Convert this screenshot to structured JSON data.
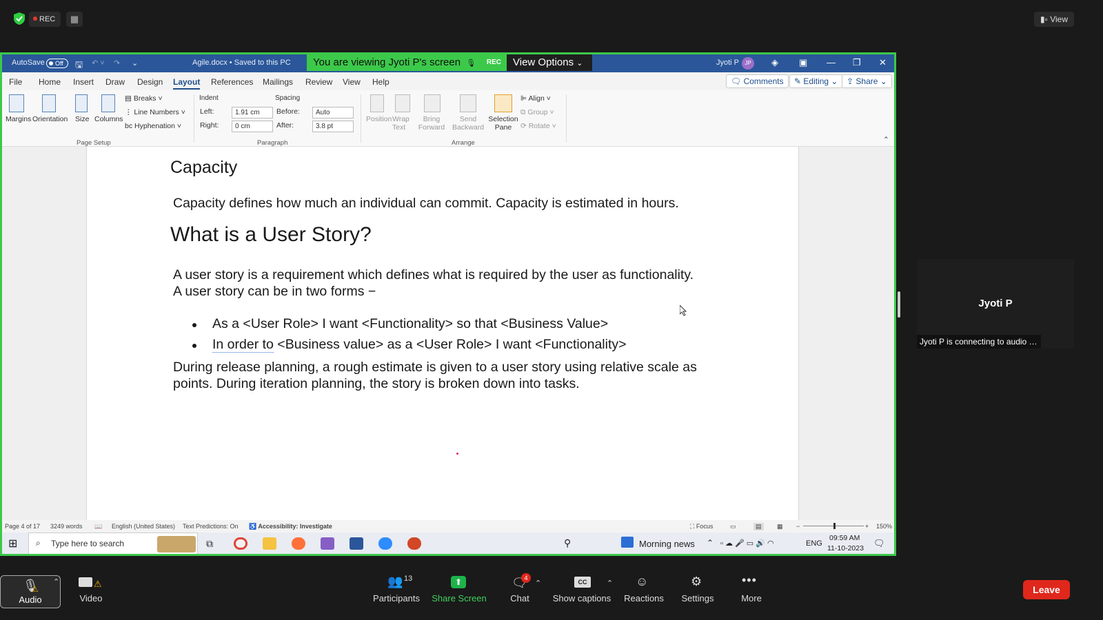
{
  "zoom_top": {
    "rec_label": "REC",
    "view_label": "View"
  },
  "word": {
    "autosave": "AutoSave",
    "autosave_state": "Off",
    "doc_title": "Agile.docx • Saved to this PC",
    "user": "Jyoti P",
    "user_initials": "JP",
    "banner": "You are viewing Jyoti P's screen",
    "banner_rec": "REC",
    "view_options": "View Options",
    "menu": [
      "File",
      "Home",
      "Insert",
      "Draw",
      "Design",
      "Layout",
      "References",
      "Mailings",
      "Review",
      "View",
      "Help"
    ],
    "active_menu": "Layout",
    "comments": "Comments",
    "editing": "Editing",
    "share": "Share",
    "ribbon": {
      "margins": "Margins",
      "orientation": "Orientation",
      "size": "Size",
      "columns": "Columns",
      "breaks": "Breaks",
      "line_numbers": "Line Numbers",
      "hyphenation": "Hyphenation",
      "page_setup": "Page Setup",
      "indent": "Indent",
      "left_label": "Left:",
      "left_value": "1.91 cm",
      "right_label": "Right:",
      "right_value": "0 cm",
      "spacing": "Spacing",
      "before_label": "Before:",
      "before_value": "Auto",
      "after_label": "After:",
      "after_value": "3.8 pt",
      "paragraph": "Paragraph",
      "position": "Position",
      "wrap_text": "Wrap Text",
      "bring_forward": "Bring Forward",
      "send_backward": "Send Backward",
      "selection_pane": "Selection Pane",
      "align": "Align",
      "group": "Group",
      "rotate": "Rotate",
      "arrange": "Arrange"
    }
  },
  "document": {
    "heading1": "Capacity",
    "para1": "Capacity defines how much an individual can commit. Capacity is estimated in hours.",
    "heading2": "What is a User Story?",
    "para2_line1": "A user story is a requirement which defines what is required by the user as functionality.",
    "para2_line2": "A user story can be in two forms −",
    "bullet1": "As a <User Role> I want <Functionality> so that <Business Value>",
    "bullet2_underlined": "In order to",
    "bullet2_rest": " <Business value> as a <User Role> I want <Functionality>",
    "para3_line1": "During release planning, a rough estimate is given to a user story using relative scale as",
    "para3_line2": "points. During iteration planning, the story is broken down into tasks."
  },
  "status_bar": {
    "page": "Page 4 of 17",
    "words": "3249 words",
    "language": "English (United States)",
    "predictions": "Text Predictions: On",
    "accessibility": "Accessibility: Investigate",
    "focus": "Focus",
    "zoom": "150%"
  },
  "taskbar": {
    "search_placeholder": "Type here to search",
    "news": "Morning news",
    "lang": "ENG",
    "time": "09:59 AM",
    "date": "11-10-2023"
  },
  "participant": {
    "name": "Jyoti P",
    "status": "Jyoti P is connecting to audio …"
  },
  "bottom_bar": {
    "audio": "Audio",
    "video": "Video",
    "participants": "Participants",
    "participants_count": "13",
    "share_screen": "Share Screen",
    "chat": "Chat",
    "chat_badge": "4",
    "captions": "Show captions",
    "captions_icon": "CC",
    "reactions": "Reactions",
    "settings": "Settings",
    "more": "More",
    "leave": "Leave"
  }
}
